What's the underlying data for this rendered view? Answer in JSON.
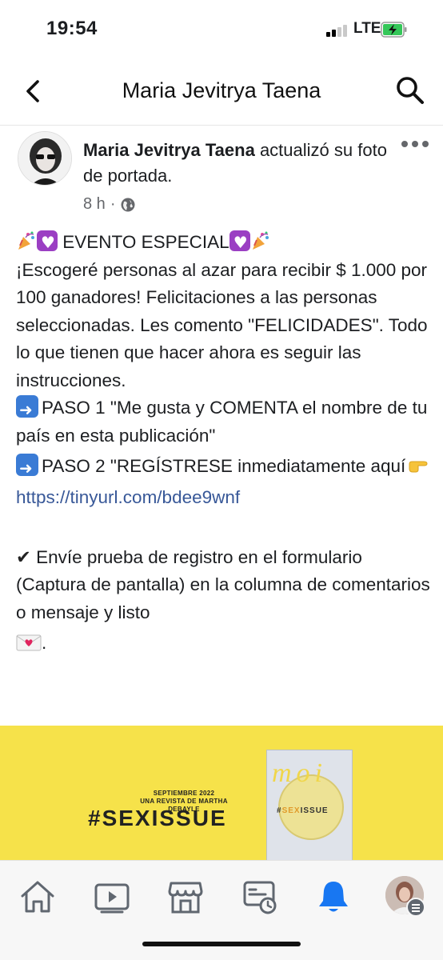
{
  "status_bar": {
    "time": "19:54",
    "network": "LTE",
    "icons": [
      "signal-icon",
      "battery-charging-icon"
    ]
  },
  "nav": {
    "title": "Maria Jevitrya Taena",
    "icons": [
      "back-chevron-icon",
      "search-icon"
    ]
  },
  "post": {
    "author": "Maria Jevitrya Taena",
    "action": " actualizó su foto de portada.",
    "time": "8 h",
    "separator": "·",
    "audience_icon": "globe-icon",
    "menu_icon": "more-dots-icon",
    "headline": "EVENTO ESPECIAL",
    "intro": "¡Escogeré personas al azar para recibir $ 1.000 por 100 ganadores! Felicitaciones a las personas seleccionadas. Les comento \"FELICIDADES\". Todo lo que tienen que hacer ahora es seguir las instrucciones.",
    "step1": "PASO 1 \"Me gusta y COMENTA el nombre de tu país en esta publicación\"",
    "step2": "PASO 2 \"REGÍSTRESE inmediatamente aquí",
    "link": "https://tinyurl.com/bdee9wnf",
    "closing": "Envíe prueba de registro en el formulario (Captura de pantalla) en la columna de comentarios o mensaje y listo",
    "closing_end": ".",
    "check_mark": "✔"
  },
  "banner": {
    "date_line1": "SEPTIEMBRE 2022",
    "date_line2": "UNA REVISTA DE MARTHA DEBAYLE",
    "hashtag": "#SEXISSUE",
    "mag_title": "moi",
    "mag_sub_hash": "#",
    "mag_sub_orange": "SEX",
    "mag_sub_rest": "ISSUE"
  },
  "tabbar": {
    "tabs": [
      "home-icon",
      "video-icon",
      "marketplace-icon",
      "feeds-icon",
      "notifications-icon",
      "profile-menu-icon"
    ],
    "active": "notifications-icon",
    "accent": "#1877f2"
  }
}
